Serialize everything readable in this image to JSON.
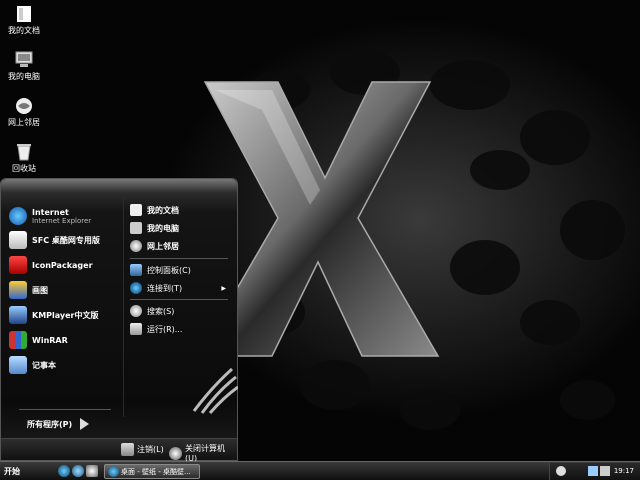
{
  "desktop": {
    "icons": [
      {
        "label": "我的文档",
        "icon": "my-documents-icon"
      },
      {
        "label": "我的电脑",
        "icon": "my-computer-icon"
      },
      {
        "label": "网上邻居",
        "icon": "network-icon"
      },
      {
        "label": "回收站",
        "icon": "recycle-bin-icon"
      }
    ]
  },
  "start_menu": {
    "left_items": [
      {
        "label": "Internet",
        "sublabel": "Internet Explorer",
        "icon": "internet-explorer-icon"
      },
      {
        "label": "SFC 桌酷网专用版",
        "icon": "sfc-icon"
      },
      {
        "label": "IconPackager",
        "icon": "iconpackager-icon"
      },
      {
        "label": "画图",
        "icon": "paint-icon"
      },
      {
        "label": "KMPlayer中文版",
        "icon": "kmplayer-icon"
      },
      {
        "label": "WinRAR",
        "icon": "winrar-icon"
      },
      {
        "label": "记事本",
        "icon": "notepad-icon"
      }
    ],
    "all_programs": "所有程序(P)",
    "right_items": [
      {
        "label": "我的文档",
        "icon": "my-documents-icon"
      },
      {
        "label": "我的电脑",
        "icon": "my-computer-icon"
      },
      {
        "label": "网上邻居",
        "icon": "network-icon"
      },
      {
        "label": "控制面板(C)",
        "icon": "control-panel-icon"
      },
      {
        "label": "连接到(T)",
        "icon": "connect-icon"
      },
      {
        "label": "搜索(S)",
        "icon": "search-icon"
      },
      {
        "label": "运行(R)...",
        "icon": "run-icon"
      }
    ],
    "logoff": "注销(L)",
    "shutdown": "关闭计算机(U)"
  },
  "taskbar": {
    "start_label": "开始",
    "task_label": "桌面 - 壁纸 - 桌酷壁...",
    "clock": "19:17"
  },
  "colors": {
    "accent": "#5a5a5a",
    "background": "#000000"
  }
}
